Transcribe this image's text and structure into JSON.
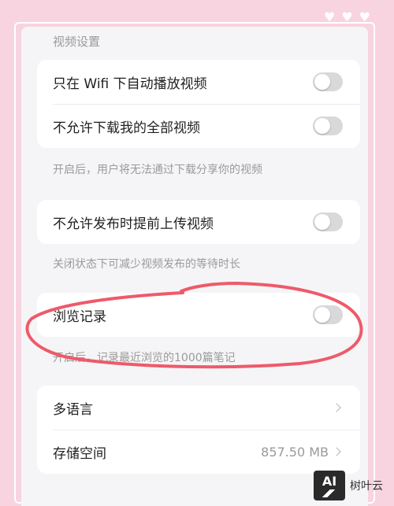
{
  "decor": {
    "hearts": [
      "♥",
      "♥",
      "♥"
    ]
  },
  "section_title": "视频设置",
  "video_card": {
    "items": [
      {
        "label": "只在 Wifi 下自动播放视频",
        "toggle_on": false
      },
      {
        "label": "不允许下载我的全部视频",
        "toggle_on": false
      }
    ]
  },
  "hint_download": "开启后，用户将无法通过下载分享你的视频",
  "upload_card": {
    "label": "不允许发布时提前上传视频",
    "toggle_on": false
  },
  "hint_upload": "关闭状态下可减少视频发布的等待时长",
  "history_card": {
    "label": "浏览记录",
    "toggle_on": false
  },
  "hint_history": "开启后，记录最近浏览的1000篇笔记",
  "general_card": {
    "language_label": "多语言",
    "storage_label": "存储空间",
    "storage_value": "857.50 MB"
  },
  "annotation": {
    "color": "#ee5a6a"
  },
  "watermark": {
    "logo": "AI",
    "text": "树叶云"
  }
}
